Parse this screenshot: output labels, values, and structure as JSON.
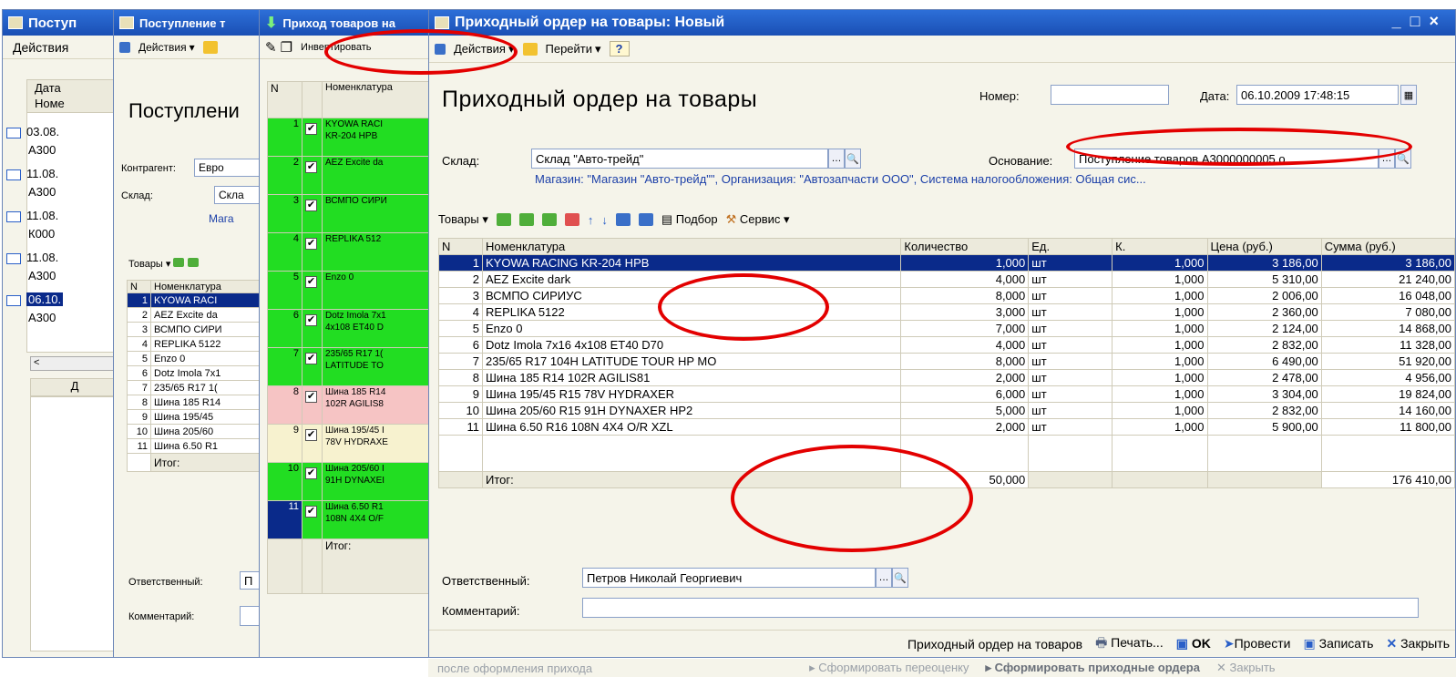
{
  "win1": {
    "title": "Поступ",
    "actions": "Действия",
    "col_date": "Дата",
    "col_num": "Номе",
    "rows": [
      {
        "d": "03.08.",
        "n": "А300"
      },
      {
        "d": "11.08.",
        "n": "А300"
      },
      {
        "d": "11.08.",
        "n": "К000"
      },
      {
        "d": "11.08.",
        "n": "А300"
      },
      {
        "d": "06.10.",
        "n": "А300"
      }
    ],
    "scroll_left": "<",
    "bottom_col": "Д"
  },
  "win2": {
    "title": "Поступление т",
    "actions": "Действия",
    "heading": "Поступлени",
    "contragent_label": "Контрагент:",
    "contragent_value": "Евро",
    "warehouse_label": "Склад:",
    "warehouse_value": "Скла",
    "shop_link": "Мага",
    "goods_menu": "Товары",
    "col_n": "N",
    "col_nom": "Номенклатура",
    "rows": [
      {
        "n": "1",
        "name": "KYOWA RACI"
      },
      {
        "n": "2",
        "name": "AEZ Excite da"
      },
      {
        "n": "3",
        "name": "ВСМПО СИРИ"
      },
      {
        "n": "4",
        "name": "REPLIKA 5122"
      },
      {
        "n": "5",
        "name": "Enzo 0"
      },
      {
        "n": "6",
        "name": "Dotz Imola 7x1"
      },
      {
        "n": "7",
        "name": "235/65 R17 1("
      },
      {
        "n": "8",
        "name": "Шина 185 R14"
      },
      {
        "n": "9",
        "name": "Шина 195/45"
      },
      {
        "n": "10",
        "name": "Шина 205/60"
      },
      {
        "n": "11",
        "name": "Шина 6.50 R1"
      }
    ],
    "total_label": "Итог:",
    "responsible_label": "Ответственный:",
    "responsible_value": "П",
    "comment_label": "Комментарий:"
  },
  "win3": {
    "title": "Приход товаров на",
    "invert": "Инвертировать",
    "col_n": "N",
    "col_nom": "Номенклатура",
    "rows": [
      {
        "n": "1",
        "l1": "KYOWA RACI",
        "l2": "KR-204 HPB",
        "color": "#22dd22"
      },
      {
        "n": "2",
        "l1": "AEZ Excite da",
        "l2": "",
        "color": "#22dd22"
      },
      {
        "n": "3",
        "l1": "ВСМПО СИРИ",
        "l2": "",
        "color": "#22dd22"
      },
      {
        "n": "4",
        "l1": "REPLIKA 512",
        "l2": "",
        "color": "#22dd22"
      },
      {
        "n": "5",
        "l1": "Enzo 0",
        "l2": "",
        "color": "#22dd22"
      },
      {
        "n": "6",
        "l1": "Dotz Imola 7x1",
        "l2": "4x108 ET40 D",
        "color": "#22dd22"
      },
      {
        "n": "7",
        "l1": "235/65 R17 1(",
        "l2": "LATITUDE TO",
        "color": "#22dd22"
      },
      {
        "n": "8",
        "l1": "Шина 185 R14",
        "l2": "102R AGILIS8",
        "color": "#f6c4c4"
      },
      {
        "n": "9",
        "l1": "Шина 195/45 I",
        "l2": "78V HYDRAXE",
        "color": "#f7f2cf"
      },
      {
        "n": "10",
        "l1": "Шина 205/60 I",
        "l2": "91H DYNAXEI",
        "color": "#22dd22"
      },
      {
        "n": "11",
        "l1": "Шина 6.50 R1",
        "l2": "108N 4X4 O/F",
        "color": "#22dd22"
      }
    ],
    "total_label": "Итог:"
  },
  "main": {
    "title": "Приходный ордер на товары: Новый",
    "min": "_",
    "max": "□",
    "close": "×",
    "actions": "Действия",
    "goto": "Перейти",
    "help": "?",
    "heading": "Приходный ордер на товары",
    "number_label": "Номер:",
    "number_value": "",
    "date_label": "Дата:",
    "date_value": "06.10.2009 17:48:15",
    "warehouse_label": "Склад:",
    "warehouse_value": "Склад \"Авто-трейд\"",
    "basis_label": "Основание:",
    "basis_value": "Поступление товаров А3000000005 о",
    "info_line": "Магазин: \"Магазин \"Авто-трейд\"\", Организация: \"Автозапчасти ООО\", Система налогообложения: Общая сис...",
    "goods_menu": "Товары",
    "select_btn": "Подбор",
    "service_btn": "Сервис",
    "columns": [
      "N",
      "Номенклатура",
      "Количество",
      "Ед.",
      "К.",
      "Цена (руб.)",
      "Сумма (руб.)"
    ],
    "rows": [
      {
        "n": "1",
        "name": "KYOWA RACING KR-204 HPB",
        "qty": "1,000",
        "unit": "шт",
        "k": "1,000",
        "price": "3 186,00",
        "sum": "3 186,00"
      },
      {
        "n": "2",
        "name": "AEZ Excite dark",
        "qty": "4,000",
        "unit": "шт",
        "k": "1,000",
        "price": "5 310,00",
        "sum": "21 240,00"
      },
      {
        "n": "3",
        "name": "ВСМПО СИРИУС",
        "qty": "8,000",
        "unit": "шт",
        "k": "1,000",
        "price": "2 006,00",
        "sum": "16 048,00"
      },
      {
        "n": "4",
        "name": "REPLIKA 5122",
        "qty": "3,000",
        "unit": "шт",
        "k": "1,000",
        "price": "2 360,00",
        "sum": "7 080,00"
      },
      {
        "n": "5",
        "name": "Enzo 0",
        "qty": "7,000",
        "unit": "шт",
        "k": "1,000",
        "price": "2 124,00",
        "sum": "14 868,00"
      },
      {
        "n": "6",
        "name": "Dotz Imola 7x16 4x108 ET40 D70",
        "qty": "4,000",
        "unit": "шт",
        "k": "1,000",
        "price": "2 832,00",
        "sum": "11 328,00"
      },
      {
        "n": "7",
        "name": "235/65 R17 104H  LATITUDE TOUR HP MO",
        "qty": "8,000",
        "unit": "шт",
        "k": "1,000",
        "price": "6 490,00",
        "sum": "51 920,00"
      },
      {
        "n": "8",
        "name": "Шина 185 R14 102R AGILIS81",
        "qty": "2,000",
        "unit": "шт",
        "k": "1,000",
        "price": "2 478,00",
        "sum": "4 956,00"
      },
      {
        "n": "9",
        "name": "Шина 195/45 R15 78V HYDRAXER",
        "qty": "6,000",
        "unit": "шт",
        "k": "1,000",
        "price": "3 304,00",
        "sum": "19 824,00"
      },
      {
        "n": "10",
        "name": "Шина 205/60 R15 91H DYNAXER HP2",
        "qty": "5,000",
        "unit": "шт",
        "k": "1,000",
        "price": "2 832,00",
        "sum": "14 160,00"
      },
      {
        "n": "11",
        "name": "Шина 6.50 R16 108N 4X4 O/R XZL",
        "qty": "2,000",
        "unit": "шт",
        "k": "1,000",
        "price": "5 900,00",
        "sum": "11 800,00"
      }
    ],
    "total_label": "Итог:",
    "total_qty": "50,000",
    "total_sum": "176 410,00",
    "responsible_label": "Ответственный:",
    "responsible_value": "Петров Николай Георгиевич",
    "comment_label": "Комментарий:",
    "comment_value": "",
    "footer_doc": "Приходный ордер на товаров",
    "print_btn": "Печать...",
    "ok_btn": "OK",
    "post_btn": "Провести",
    "save_btn": "Записать",
    "close_btn": "Закрыть"
  },
  "bottom_strip": {
    "left": "после оформления прихода",
    "mid1": "Сформировать переоценку",
    "mid2": "Сформировать приходные ордера",
    "right": "Закрыть"
  },
  "colors": {
    "title_bar": "#1a4fb4",
    "selection": "#0a2a8a",
    "annotation": "#e30000",
    "row_green": "#22dd22"
  }
}
